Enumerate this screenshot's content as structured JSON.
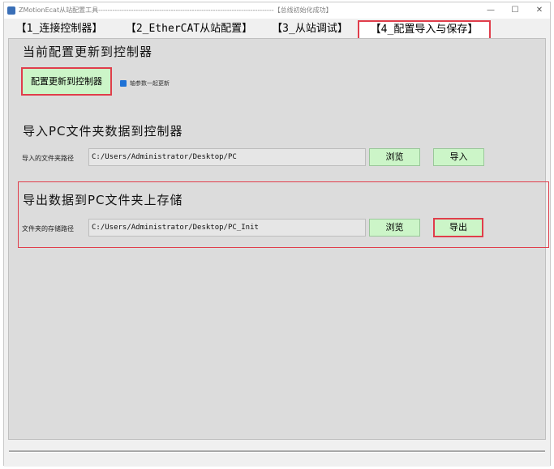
{
  "window": {
    "title": "ZMotionEcat从站配置工具---------------------------------------------------------------------------【总线初始化成功】",
    "minimize": "—",
    "maximize": "☐",
    "close": "✕"
  },
  "tabs": [
    {
      "label": "【1_连接控制器】"
    },
    {
      "label": "【2_EtherCAT从站配置】"
    },
    {
      "label": "【3_从站调试】"
    },
    {
      "label": "【4_配置导入与保存】",
      "active": true
    }
  ],
  "update_section": {
    "title": "当前配置更新到控制器",
    "button": "配置更新到控制器",
    "checkbox_label": "轴参数一起更新",
    "checkbox_checked": true
  },
  "import_section": {
    "title": "导入PC文件夹数据到控制器",
    "path_label": "导入的文件夹路径",
    "path_value": "C:/Users/Administrator/Desktop/PC",
    "browse_button": "浏览",
    "import_button": "导入"
  },
  "export_section": {
    "title": "导出数据到PC文件夹上存储",
    "path_label": "文件夹的存储路径",
    "path_value": "C:/Users/Administrator/Desktop/PC_Init",
    "browse_button": "浏览",
    "export_button": "导出"
  },
  "colors": {
    "highlight_red": "#e03d4b",
    "button_green": "#ccf5c8",
    "panel_gray": "#dcdcdc",
    "checkbox_blue": "#1e72d6"
  }
}
